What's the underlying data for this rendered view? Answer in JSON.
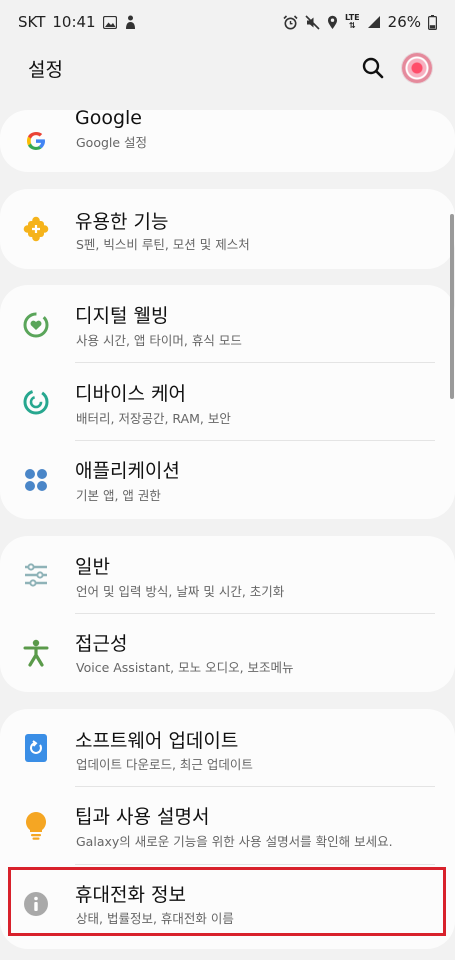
{
  "status_bar": {
    "carrier": "SKT",
    "time": "10:41",
    "battery": "26%",
    "network": "LTE"
  },
  "header": {
    "title": "설정"
  },
  "items": [
    {
      "title": "Google",
      "subtitle": "Google 설정",
      "icon": "google-icon",
      "color": "#4285f4"
    },
    {
      "title": "유용한 기능",
      "subtitle": "S펜, 빅스비 루틴, 모션 및 제스처",
      "icon": "puzzle-icon",
      "color": "#f5b31b"
    },
    {
      "title": "디지털 웰빙",
      "subtitle": "사용 시간, 앱 타이머, 휴식 모드",
      "icon": "digital-wellbeing-icon",
      "color": "#5aa55a"
    },
    {
      "title": "디바이스 케어",
      "subtitle": "배터리, 저장공간, RAM, 보안",
      "icon": "device-care-icon",
      "color": "#27a78f"
    },
    {
      "title": "애플리케이션",
      "subtitle": "기본 앱, 앱 권한",
      "icon": "apps-icon",
      "color": "#4a86c8"
    },
    {
      "title": "일반",
      "subtitle": "언어 및 입력 방식, 날짜 및 시간, 초기화",
      "icon": "sliders-icon",
      "color": "#8fb3b8"
    },
    {
      "title": "접근성",
      "subtitle": "Voice Assistant, 모노 오디오, 보조메뉴",
      "icon": "accessibility-icon",
      "color": "#5a9a4a"
    },
    {
      "title": "소프트웨어 업데이트",
      "subtitle": "업데이트 다운로드, 최근 업데이트",
      "icon": "software-update-icon",
      "color": "#3a8ee6"
    },
    {
      "title": "팁과 사용 설명서",
      "subtitle": "Galaxy의 새로운 기능을 위한 사용 설명서를 확인해 보세요.",
      "icon": "lightbulb-icon",
      "color": "#f5a623"
    },
    {
      "title": "휴대전화 정보",
      "subtitle": "상태, 법률정보, 휴대전화 이름",
      "icon": "info-icon",
      "color": "#a9a9a9"
    }
  ]
}
